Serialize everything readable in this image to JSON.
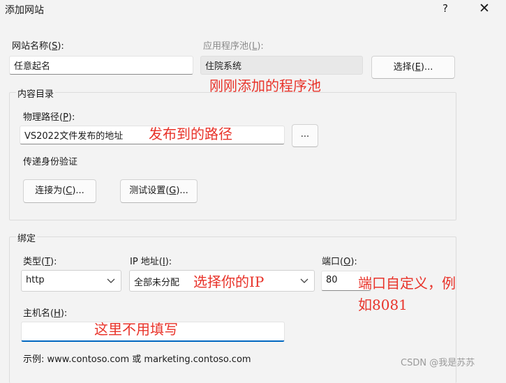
{
  "window": {
    "title": "添加网站",
    "help_glyph": "?",
    "close_glyph": "✕"
  },
  "site_name": {
    "label_prefix": "网站名称(",
    "label_key": "S",
    "label_suffix": "):",
    "value": "任意起名"
  },
  "app_pool": {
    "label_prefix": "应用程序池(",
    "label_key": "L",
    "label_suffix": "):",
    "value": "住院系统",
    "select_button_prefix": "选择(",
    "select_button_key": "E",
    "select_button_suffix": ")..."
  },
  "content_dir": {
    "group_title": "内容目录",
    "path_label_prefix": "物理路径(",
    "path_label_key": "P",
    "path_label_suffix": "):",
    "path_value": "VS2022文件发布的地址",
    "browse_label": "...",
    "auth_label": "传递身份验证",
    "connect_as_prefix": "连接为(",
    "connect_as_key": "C",
    "connect_as_suffix": ")...",
    "test_settings_prefix": "测试设置(",
    "test_settings_key": "G",
    "test_settings_suffix": ")..."
  },
  "binding": {
    "group_title": "绑定",
    "type_label_prefix": "类型(",
    "type_label_key": "T",
    "type_label_suffix": "):",
    "type_value": "http",
    "ip_label_prefix": "IP 地址(",
    "ip_label_key": "I",
    "ip_label_suffix": "):",
    "ip_value": "全部未分配",
    "port_label_prefix": "端口(",
    "port_label_key": "O",
    "port_label_suffix": "):",
    "port_value": "80",
    "host_label_prefix": "主机名(",
    "host_label_key": "H",
    "host_label_suffix": "):",
    "host_value": "",
    "example_text": "示例: www.contoso.com 或 marketing.contoso.com"
  },
  "annotations": {
    "app_pool_note": "刚刚添加的程序池",
    "path_note": "发布到的路径",
    "ip_note": "选择你的IP",
    "port_note_line1": "端口自定义，例",
    "port_note_line2": "如8081",
    "host_note": "这里不用填写"
  },
  "watermark": "CSDN @我是苏苏",
  "colors": {
    "annotation": "#e8332a",
    "focus_accent": "#0067c0",
    "dialog_bg": "#f3f3f3"
  }
}
